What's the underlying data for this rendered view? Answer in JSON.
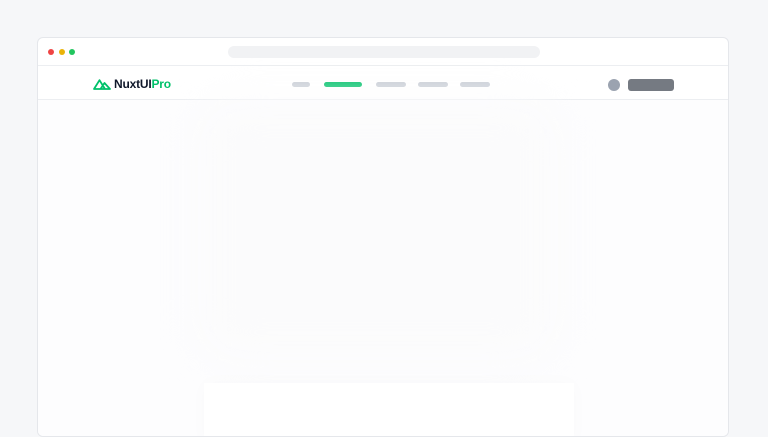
{
  "window": {
    "controls": [
      "close",
      "minimize",
      "maximize"
    ]
  },
  "navbar": {
    "logo": {
      "icon": "nuxt-mountain-icon",
      "name": "NuxtUI",
      "suffix": "Pro"
    },
    "links": [
      {
        "state": "inactive"
      },
      {
        "state": "active"
      },
      {
        "state": "inactive"
      },
      {
        "state": "inactive"
      },
      {
        "state": "inactive"
      }
    ]
  },
  "colors": {
    "accent": "#00c16a",
    "close": "#ef4444",
    "minimize": "#eab308",
    "maximize": "#22c55e",
    "placeholder": "#c9ced6",
    "avatar": "#9ba3b0",
    "button": "#757a82"
  }
}
